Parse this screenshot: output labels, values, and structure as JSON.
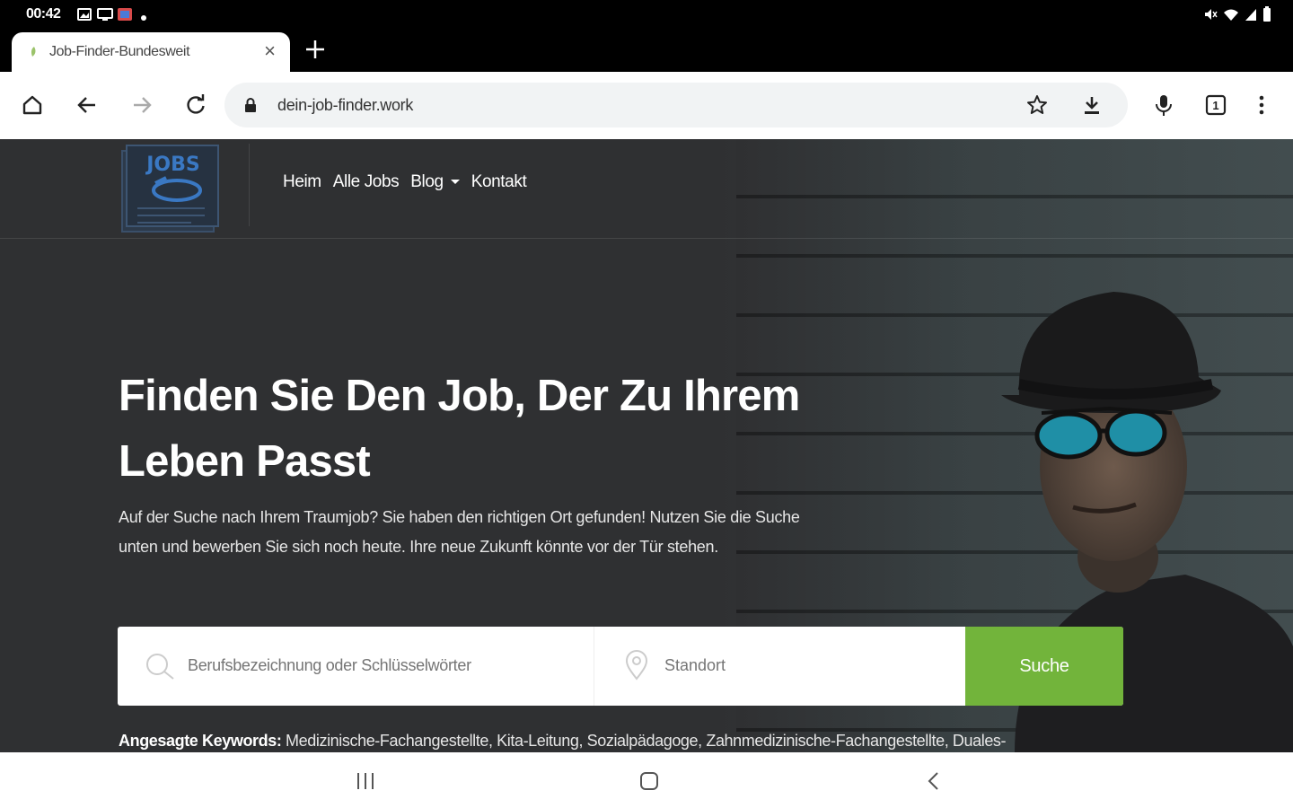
{
  "status_bar": {
    "time": "00:42"
  },
  "tab": {
    "title": "Job-Finder-Bundesweit",
    "close": "×"
  },
  "toolbar": {
    "url": "dein-job-finder.work"
  },
  "site": {
    "logo_text": "JOBS",
    "nav": [
      {
        "label": "Heim"
      },
      {
        "label": "Alle Jobs"
      },
      {
        "label": "Blog"
      },
      {
        "label": "Kontakt"
      }
    ],
    "hero_title": "Finden Sie Den Job, Der Zu Ihrem Leben Passt",
    "hero_text": "Auf der Suche nach Ihrem Traumjob? Sie haben den richtigen Ort gefunden! Nutzen Sie die Suche unten und bewerben Sie sich noch heute. Ihre neue Zukunft könnte vor der Tür stehen.",
    "search": {
      "keyword_placeholder": "Berufsbezeichnung oder Schlüsselwörter",
      "location_placeholder": "Standort",
      "button_label": "Suche"
    },
    "keywords_label": "Angesagte Keywords:",
    "keywords_text": " Medizinische-Fachangestellte, Kita-Leitung, Sozialpädagoge, Zahnmedizinische-Fachangestellte, Duales-"
  },
  "colors": {
    "accent": "#72b43b",
    "hero_bg": "#2f3032",
    "logo_blue": "#3a78c3"
  }
}
